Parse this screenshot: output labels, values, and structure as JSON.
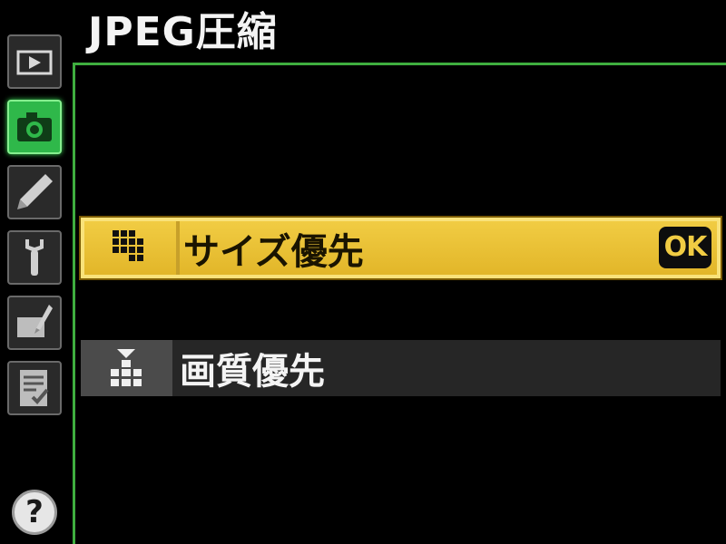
{
  "header": {
    "title": "JPEG圧縮"
  },
  "sidebar": {
    "tabs": [
      {
        "icon": "playback-icon",
        "active": false
      },
      {
        "icon": "camera-icon",
        "active": true
      },
      {
        "icon": "pencil-icon",
        "active": false
      },
      {
        "icon": "wrench-icon",
        "active": false
      },
      {
        "icon": "retouch-icon",
        "active": false
      },
      {
        "icon": "my-menu-icon",
        "active": false
      }
    ],
    "help_label": "?"
  },
  "menu": {
    "items": [
      {
        "label": "サイズ優先",
        "icon": "size-priority-icon",
        "selected": true
      },
      {
        "label": "画質優先",
        "icon": "quality-priority-icon",
        "selected": false
      }
    ],
    "ok_label": "OK"
  },
  "colors": {
    "frame_green": "#3fae3f",
    "active_tab_green": "#2fb84a",
    "highlight_yellow": "#f1cc43",
    "row_gray": "#262626"
  }
}
